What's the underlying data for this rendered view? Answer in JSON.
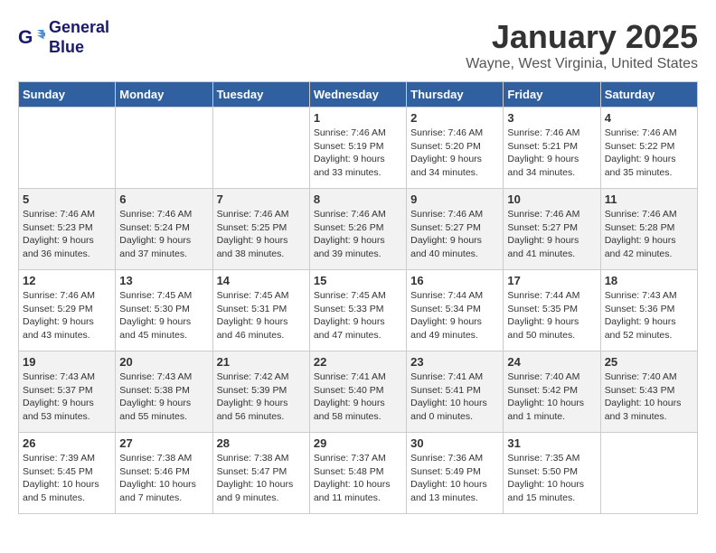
{
  "header": {
    "logo_line1": "General",
    "logo_line2": "Blue",
    "month": "January 2025",
    "location": "Wayne, West Virginia, United States"
  },
  "weekdays": [
    "Sunday",
    "Monday",
    "Tuesday",
    "Wednesday",
    "Thursday",
    "Friday",
    "Saturday"
  ],
  "weeks": [
    {
      "bg": "white",
      "days": [
        {
          "num": "",
          "info": ""
        },
        {
          "num": "",
          "info": ""
        },
        {
          "num": "",
          "info": ""
        },
        {
          "num": "1",
          "info": "Sunrise: 7:46 AM\nSunset: 5:19 PM\nDaylight: 9 hours\nand 33 minutes."
        },
        {
          "num": "2",
          "info": "Sunrise: 7:46 AM\nSunset: 5:20 PM\nDaylight: 9 hours\nand 34 minutes."
        },
        {
          "num": "3",
          "info": "Sunrise: 7:46 AM\nSunset: 5:21 PM\nDaylight: 9 hours\nand 34 minutes."
        },
        {
          "num": "4",
          "info": "Sunrise: 7:46 AM\nSunset: 5:22 PM\nDaylight: 9 hours\nand 35 minutes."
        }
      ]
    },
    {
      "bg": "light",
      "days": [
        {
          "num": "5",
          "info": "Sunrise: 7:46 AM\nSunset: 5:23 PM\nDaylight: 9 hours\nand 36 minutes."
        },
        {
          "num": "6",
          "info": "Sunrise: 7:46 AM\nSunset: 5:24 PM\nDaylight: 9 hours\nand 37 minutes."
        },
        {
          "num": "7",
          "info": "Sunrise: 7:46 AM\nSunset: 5:25 PM\nDaylight: 9 hours\nand 38 minutes."
        },
        {
          "num": "8",
          "info": "Sunrise: 7:46 AM\nSunset: 5:26 PM\nDaylight: 9 hours\nand 39 minutes."
        },
        {
          "num": "9",
          "info": "Sunrise: 7:46 AM\nSunset: 5:27 PM\nDaylight: 9 hours\nand 40 minutes."
        },
        {
          "num": "10",
          "info": "Sunrise: 7:46 AM\nSunset: 5:27 PM\nDaylight: 9 hours\nand 41 minutes."
        },
        {
          "num": "11",
          "info": "Sunrise: 7:46 AM\nSunset: 5:28 PM\nDaylight: 9 hours\nand 42 minutes."
        }
      ]
    },
    {
      "bg": "white",
      "days": [
        {
          "num": "12",
          "info": "Sunrise: 7:46 AM\nSunset: 5:29 PM\nDaylight: 9 hours\nand 43 minutes."
        },
        {
          "num": "13",
          "info": "Sunrise: 7:45 AM\nSunset: 5:30 PM\nDaylight: 9 hours\nand 45 minutes."
        },
        {
          "num": "14",
          "info": "Sunrise: 7:45 AM\nSunset: 5:31 PM\nDaylight: 9 hours\nand 46 minutes."
        },
        {
          "num": "15",
          "info": "Sunrise: 7:45 AM\nSunset: 5:33 PM\nDaylight: 9 hours\nand 47 minutes."
        },
        {
          "num": "16",
          "info": "Sunrise: 7:44 AM\nSunset: 5:34 PM\nDaylight: 9 hours\nand 49 minutes."
        },
        {
          "num": "17",
          "info": "Sunrise: 7:44 AM\nSunset: 5:35 PM\nDaylight: 9 hours\nand 50 minutes."
        },
        {
          "num": "18",
          "info": "Sunrise: 7:43 AM\nSunset: 5:36 PM\nDaylight: 9 hours\nand 52 minutes."
        }
      ]
    },
    {
      "bg": "light",
      "days": [
        {
          "num": "19",
          "info": "Sunrise: 7:43 AM\nSunset: 5:37 PM\nDaylight: 9 hours\nand 53 minutes."
        },
        {
          "num": "20",
          "info": "Sunrise: 7:43 AM\nSunset: 5:38 PM\nDaylight: 9 hours\nand 55 minutes."
        },
        {
          "num": "21",
          "info": "Sunrise: 7:42 AM\nSunset: 5:39 PM\nDaylight: 9 hours\nand 56 minutes."
        },
        {
          "num": "22",
          "info": "Sunrise: 7:41 AM\nSunset: 5:40 PM\nDaylight: 9 hours\nand 58 minutes."
        },
        {
          "num": "23",
          "info": "Sunrise: 7:41 AM\nSunset: 5:41 PM\nDaylight: 10 hours\nand 0 minutes."
        },
        {
          "num": "24",
          "info": "Sunrise: 7:40 AM\nSunset: 5:42 PM\nDaylight: 10 hours\nand 1 minute."
        },
        {
          "num": "25",
          "info": "Sunrise: 7:40 AM\nSunset: 5:43 PM\nDaylight: 10 hours\nand 3 minutes."
        }
      ]
    },
    {
      "bg": "white",
      "days": [
        {
          "num": "26",
          "info": "Sunrise: 7:39 AM\nSunset: 5:45 PM\nDaylight: 10 hours\nand 5 minutes."
        },
        {
          "num": "27",
          "info": "Sunrise: 7:38 AM\nSunset: 5:46 PM\nDaylight: 10 hours\nand 7 minutes."
        },
        {
          "num": "28",
          "info": "Sunrise: 7:38 AM\nSunset: 5:47 PM\nDaylight: 10 hours\nand 9 minutes."
        },
        {
          "num": "29",
          "info": "Sunrise: 7:37 AM\nSunset: 5:48 PM\nDaylight: 10 hours\nand 11 minutes."
        },
        {
          "num": "30",
          "info": "Sunrise: 7:36 AM\nSunset: 5:49 PM\nDaylight: 10 hours\nand 13 minutes."
        },
        {
          "num": "31",
          "info": "Sunrise: 7:35 AM\nSunset: 5:50 PM\nDaylight: 10 hours\nand 15 minutes."
        },
        {
          "num": "",
          "info": ""
        }
      ]
    }
  ]
}
